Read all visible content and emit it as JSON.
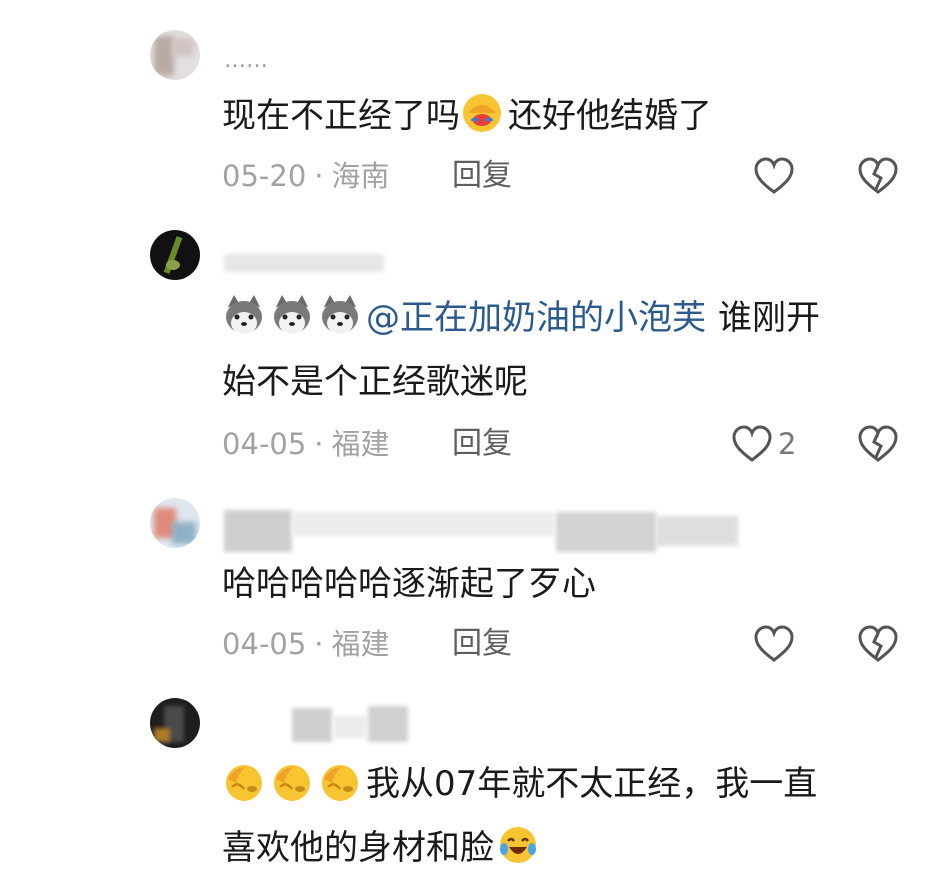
{
  "comments": [
    {
      "username": "……",
      "text_parts": [
        "现在不正经了吗",
        "还好他结婚了"
      ],
      "date": "05-20",
      "location": "海南",
      "reply_label": "回复",
      "like_count": ""
    },
    {
      "username": "",
      "mention": "@正在加奶油的小泡芙",
      "text_line1": "谁刚开",
      "text_line2": "始不是个正经歌迷呢",
      "date": "04-05",
      "location": "福建",
      "reply_label": "回复",
      "like_count": "2"
    },
    {
      "username": "",
      "text": "哈哈哈哈哈逐渐起了歹心",
      "date": "04-05",
      "location": "福建",
      "reply_label": "回复",
      "like_count": ""
    },
    {
      "username": "",
      "text_line1": "我从07年就不太正经，我一直",
      "text_line2": "喜欢他的身材和脸",
      "date": "",
      "location": "",
      "reply_label": "",
      "like_count": ""
    }
  ],
  "separator": "·",
  "icons": {
    "like": "heart-outline-icon",
    "dislike": "broken-heart-icon",
    "facepalm": "facepalm-emoji-icon",
    "husky": "husky-emoji-icon",
    "laugh_cry": "tears-of-joy-emoji-icon"
  }
}
